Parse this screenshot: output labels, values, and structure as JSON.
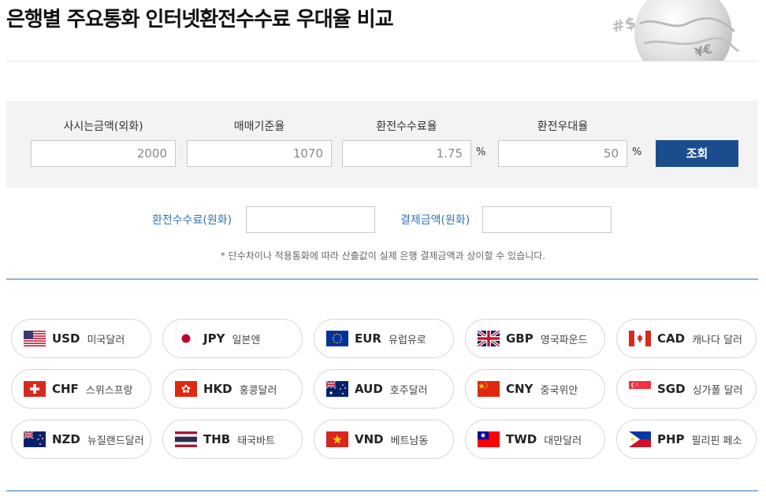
{
  "header": {
    "title": "은행별 주요통화 인터넷환전수수료 우대율 비교"
  },
  "calculator": {
    "fields": [
      {
        "label": "사시는금액(외화)",
        "value": "2000",
        "unit": ""
      },
      {
        "label": "매매기준율",
        "value": "1070",
        "unit": ""
      },
      {
        "label": "환전수수료율",
        "value": "1.75",
        "unit": "%"
      },
      {
        "label": "환전우대율",
        "value": "50",
        "unit": "%"
      }
    ],
    "submit_label": "조회"
  },
  "results": {
    "fee_label": "환전수수료(원화)",
    "payment_label": "결제금액(원화)",
    "note": "* 단수차이나 적용통화에 따라 산출값이 실제 은행 결제금액과 상이할 수 있습니다."
  },
  "currencies": [
    {
      "code": "USD",
      "name": "미국달러",
      "flag": "us-flag-icon"
    },
    {
      "code": "JPY",
      "name": "일본엔",
      "flag": "jp-flag-icon"
    },
    {
      "code": "EUR",
      "name": "유럽유로",
      "flag": "eu-flag-icon"
    },
    {
      "code": "GBP",
      "name": "영국파운드",
      "flag": "gb-flag-icon"
    },
    {
      "code": "CAD",
      "name": "캐나다 달러",
      "flag": "ca-flag-icon"
    },
    {
      "code": "CHF",
      "name": "스위스프랑",
      "flag": "ch-flag-icon"
    },
    {
      "code": "HKD",
      "name": "홍콩달러",
      "flag": "hk-flag-icon"
    },
    {
      "code": "AUD",
      "name": "호주달러",
      "flag": "au-flag-icon"
    },
    {
      "code": "CNY",
      "name": "중국위안",
      "flag": "cn-flag-icon"
    },
    {
      "code": "SGD",
      "name": "싱가폴 달러",
      "flag": "sg-flag-icon"
    },
    {
      "code": "NZD",
      "name": "뉴질랜드달러",
      "flag": "nz-flag-icon"
    },
    {
      "code": "THB",
      "name": "태국바트",
      "flag": "th-flag-icon"
    },
    {
      "code": "VND",
      "name": "베트남동",
      "flag": "vn-flag-icon"
    },
    {
      "code": "TWD",
      "name": "대만달러",
      "flag": "tw-flag-icon"
    },
    {
      "code": "PHP",
      "name": "필리핀 페소",
      "flag": "ph-flag-icon"
    }
  ],
  "colors": {
    "accent": "#1b4d8e",
    "link": "#2f75b5",
    "panel": "#f3f3f3"
  }
}
